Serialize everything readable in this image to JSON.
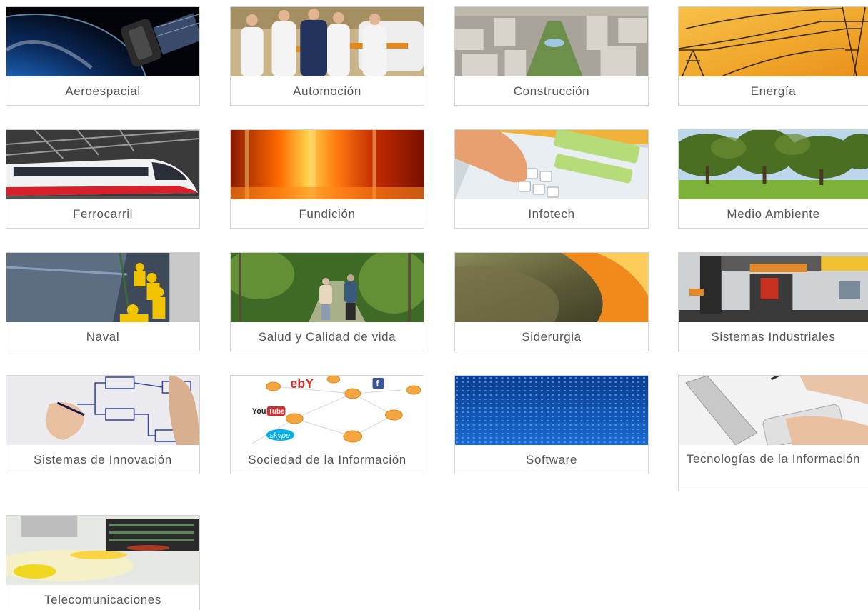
{
  "sectors": [
    {
      "label": "Aeroespacial",
      "icon": "satellite-image"
    },
    {
      "label": "Automoción",
      "icon": "lab-team-image"
    },
    {
      "label": "Construcción",
      "icon": "city-aerial-image"
    },
    {
      "label": "Energía",
      "icon": "power-pylons-image"
    },
    {
      "label": "Ferrocarril",
      "icon": "train-image"
    },
    {
      "label": "Fundición",
      "icon": "molten-metal-image"
    },
    {
      "label": "Infotech",
      "icon": "touch-keyboard-image"
    },
    {
      "label": "Medio Ambiente",
      "icon": "trees-image"
    },
    {
      "label": "Naval",
      "icon": "ship-crew-image"
    },
    {
      "label": "Salud y Calidad de vida",
      "icon": "forest-walk-image"
    },
    {
      "label": "Siderurgia",
      "icon": "steel-foil-image"
    },
    {
      "label": "Sistemas Industriales",
      "icon": "industrial-machine-image"
    },
    {
      "label": "Sistemas de Innovación",
      "icon": "flowchart-drawing-image"
    },
    {
      "label": "Sociedad de la Información",
      "icon": "social-network-image"
    },
    {
      "label": "Software",
      "icon": "binary-code-image"
    },
    {
      "label": "Tecnologías de la Información",
      "icon": "handheld-device-image"
    },
    {
      "label": "Telecomunicaciones",
      "icon": "server-light-image"
    }
  ],
  "brand_text": {
    "ebay": "ebY",
    "youtube_a": "You",
    "youtube_b": "Tube",
    "skype": "skype",
    "facebook": "f"
  }
}
